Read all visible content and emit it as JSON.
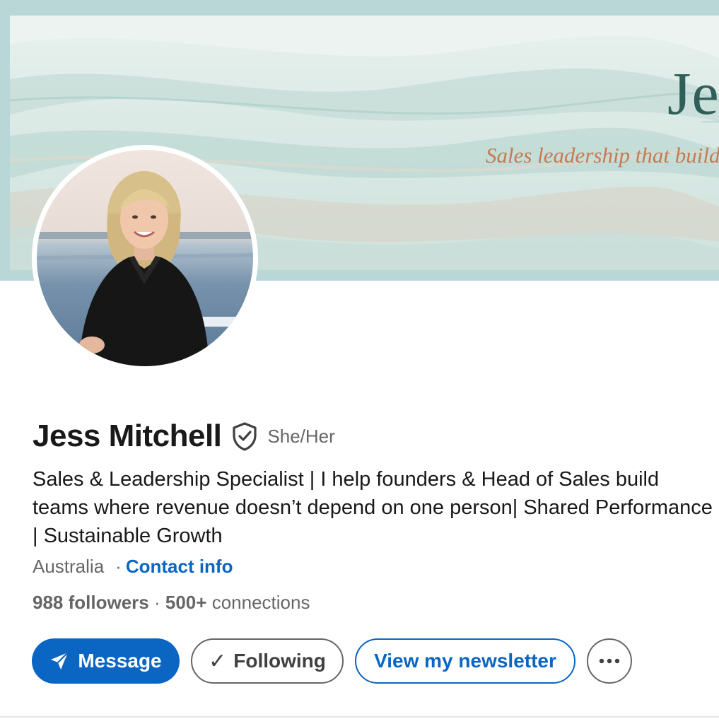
{
  "banner": {
    "title": "Je",
    "tagline": "Sales leadership that builds"
  },
  "profile": {
    "name": "Jess Mitchell",
    "pronouns": "She/Her",
    "headline": "Sales & Leadership Specialist | I help founders & Head of Sales build teams where revenue doesn’t depend on one person| Shared Performance | Sustainable Growth",
    "location": "Australia",
    "separator": "·",
    "contact_info_label": "Contact info",
    "followers_count": "988 followers",
    "connections_count": "500+",
    "connections_label": "connections"
  },
  "actions": {
    "message_label": "Message",
    "following_label": "Following",
    "following_check": "✓",
    "newsletter_label": "View my newsletter",
    "more_label": "•••"
  },
  "icons": {
    "verification": "shield-check-icon",
    "message": "paper-plane-icon",
    "following": "checkmark-icon",
    "more": "ellipsis-icon"
  },
  "colors": {
    "primary_blue": "#0a66c2",
    "text_primary": "#191919",
    "text_secondary": "#666666",
    "banner_title": "#2f5f58",
    "banner_tagline": "#c47a55"
  }
}
